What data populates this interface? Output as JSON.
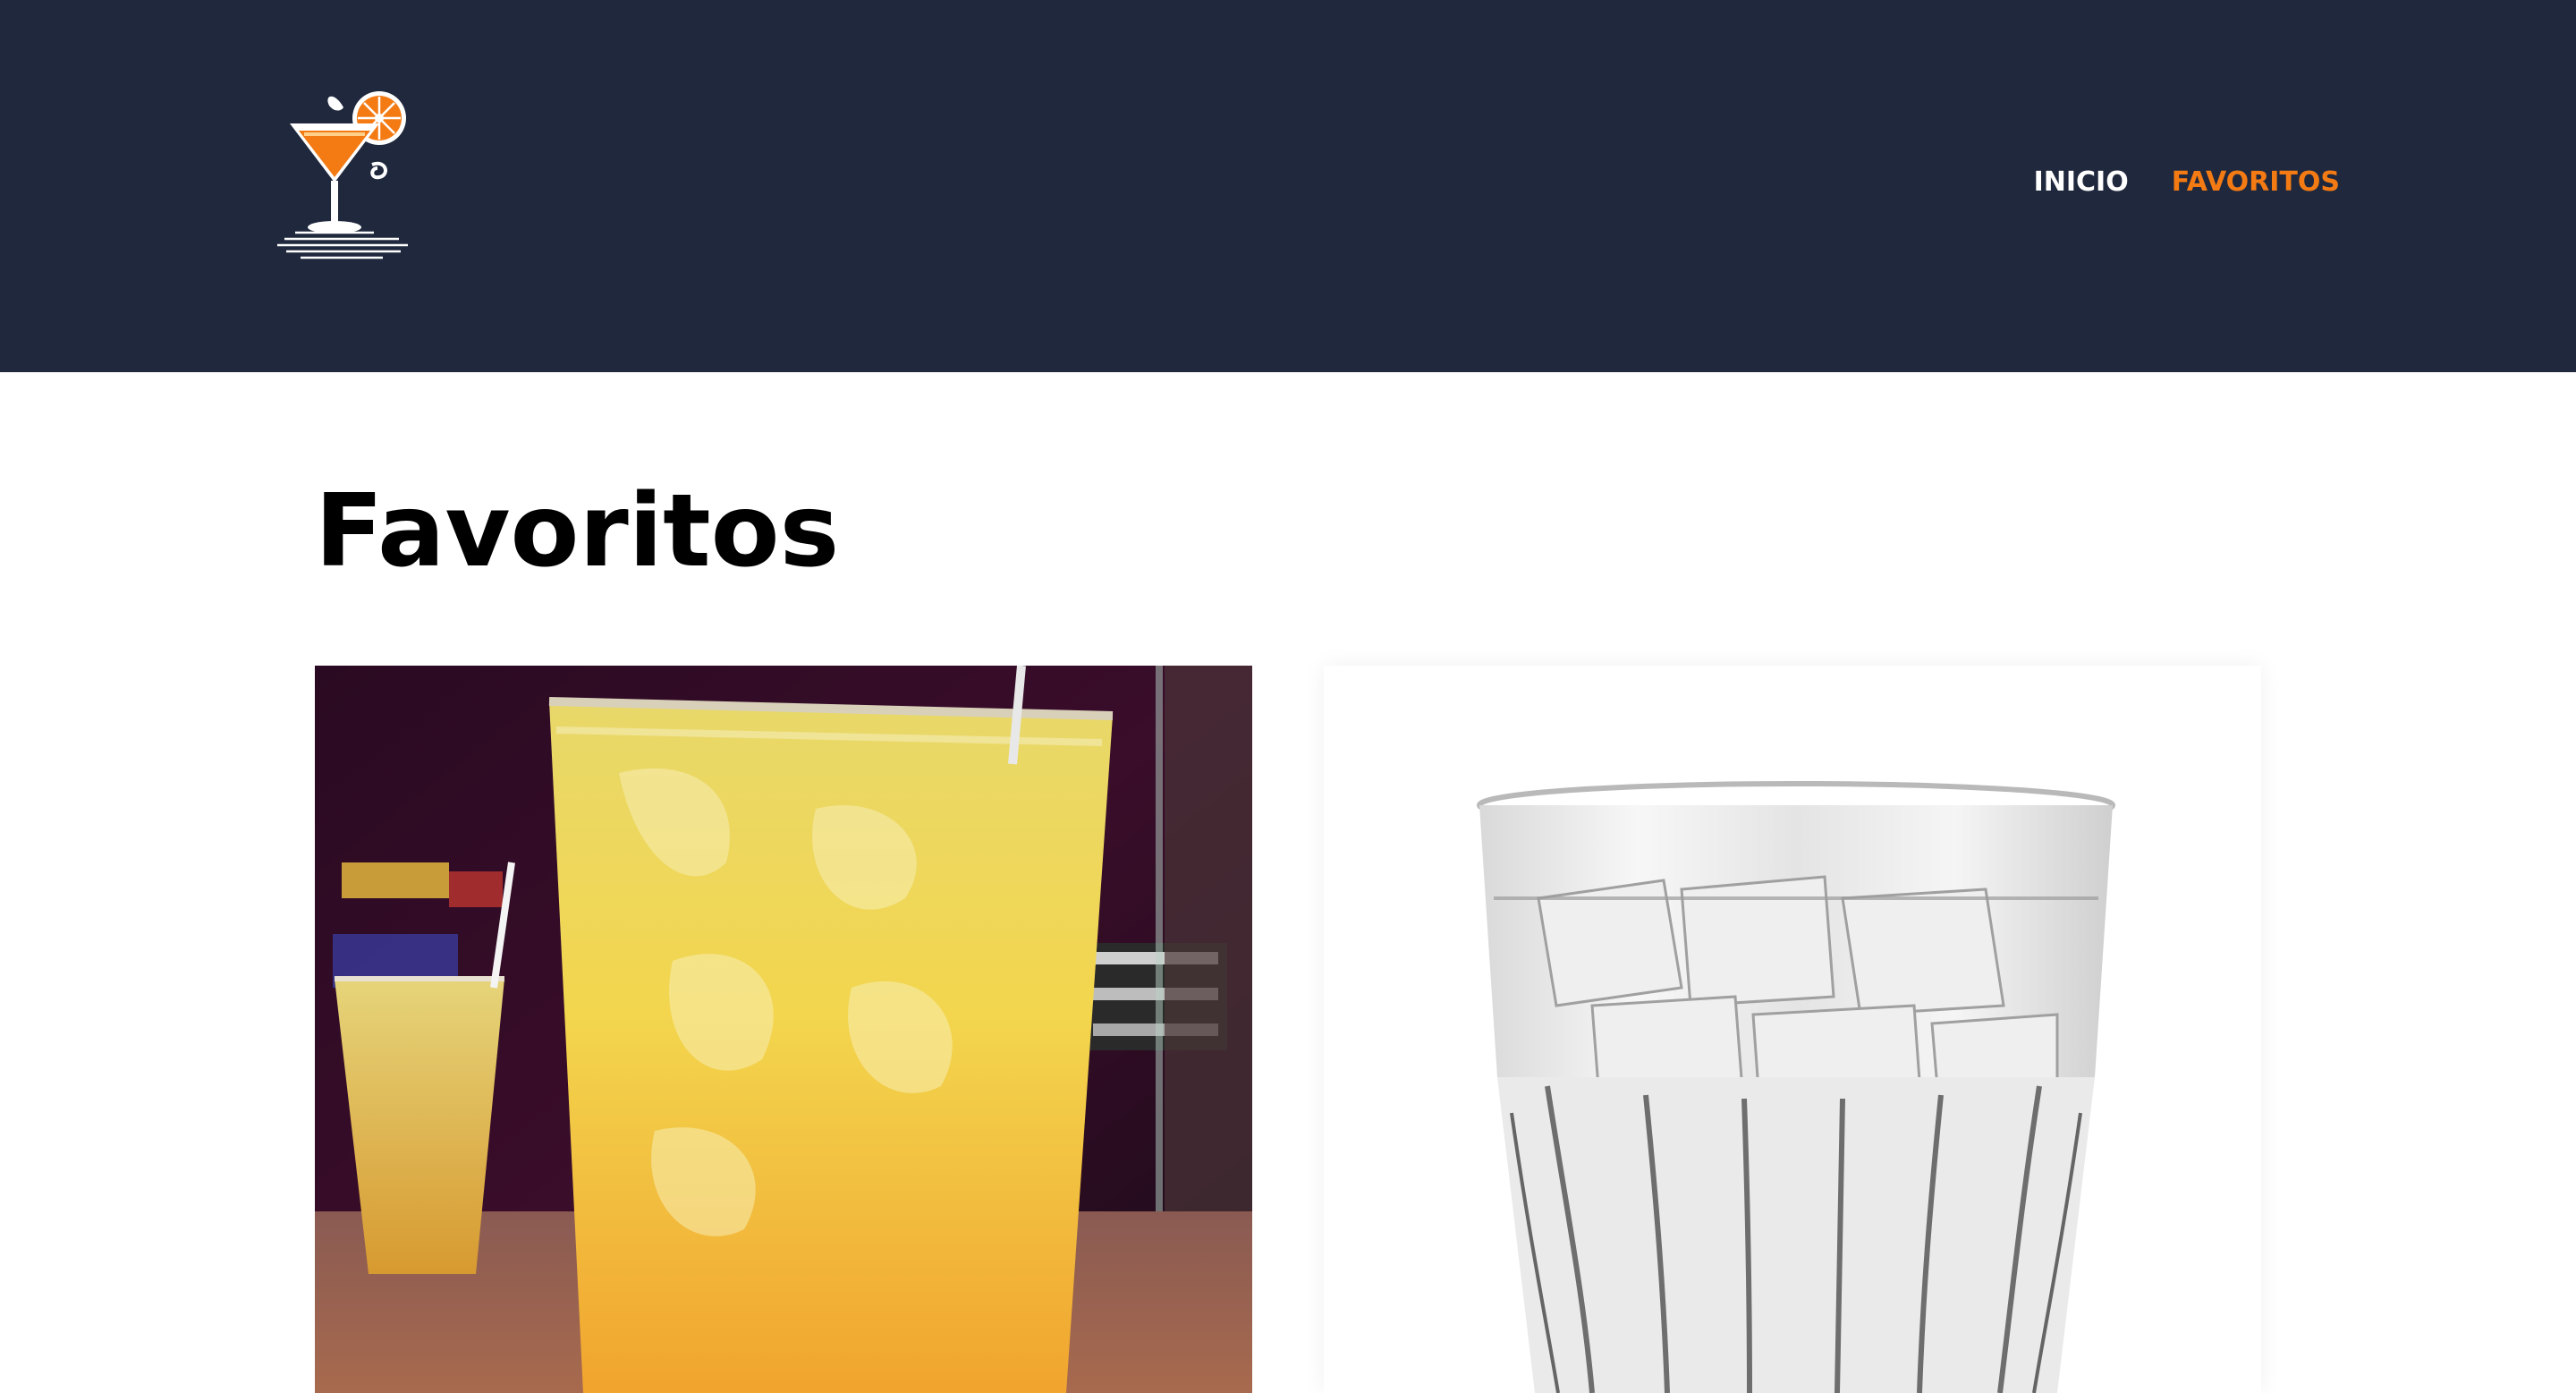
{
  "header": {
    "logo_icon": "cocktail-glass-orange-slice-icon",
    "colors": {
      "background": "#1f283d",
      "accent": "#f47b14"
    }
  },
  "nav": {
    "items": [
      {
        "label": "INICIO",
        "active": false
      },
      {
        "label": "FAVORITOS",
        "active": true
      }
    ]
  },
  "main": {
    "title": "Favoritos",
    "cards": [
      {
        "image": "orange-cocktail-photo"
      },
      {
        "image": "glass-of-ice-water-photo"
      }
    ]
  }
}
